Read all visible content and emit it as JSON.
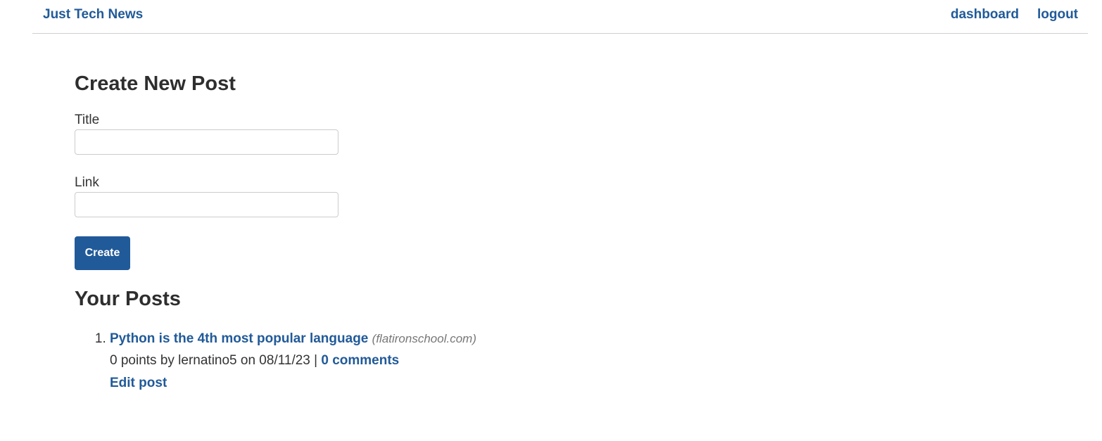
{
  "header": {
    "brand": "Just Tech News",
    "nav": {
      "dashboard": "dashboard",
      "logout": "logout"
    }
  },
  "create_form": {
    "heading": "Create New Post",
    "title_label": "Title",
    "title_value": "",
    "link_label": "Link",
    "link_value": "",
    "submit_label": "Create"
  },
  "posts_section": {
    "heading": "Your Posts",
    "posts": [
      {
        "title": "Python is the 4th most popular language",
        "domain": "(flatironschool.com)",
        "meta": "0 points by lernatino5 on 08/11/23",
        "separator": "|",
        "comments": "0 comments",
        "edit": "Edit post"
      }
    ]
  },
  "colors": {
    "link": "#215a99",
    "button_bg": "#215a99",
    "text": "#333333",
    "muted": "#777777"
  }
}
